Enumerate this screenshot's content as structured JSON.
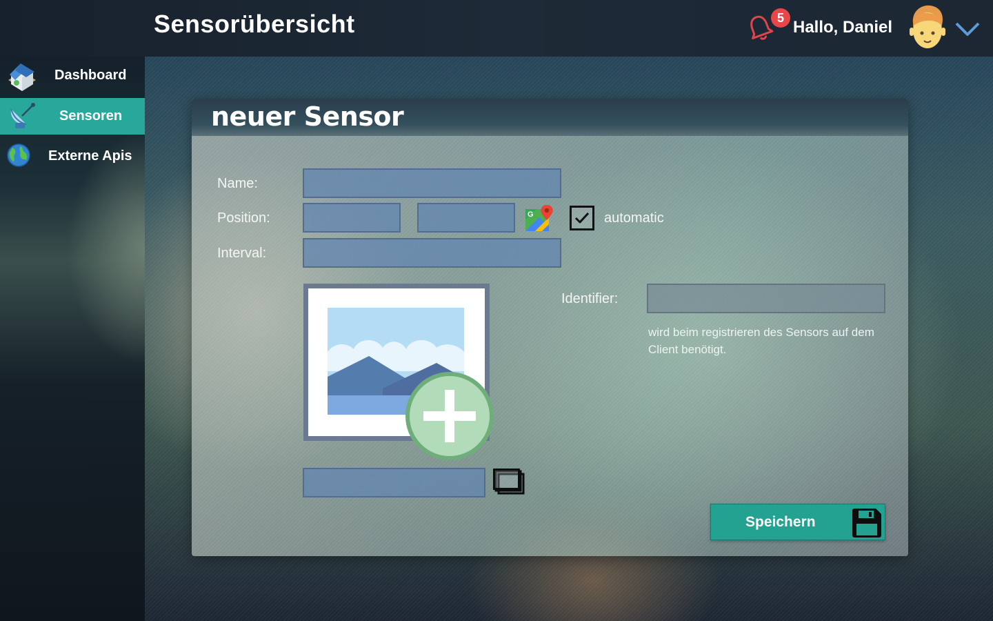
{
  "header": {
    "title": "Sensorübersicht",
    "notification_count": "5",
    "greeting": "Hallo, Daniel",
    "icons": [
      "bell-icon",
      "avatar",
      "chevron-down-icon"
    ]
  },
  "sidebar": {
    "items": [
      {
        "label": "Dashboard",
        "icon": "house-icon",
        "active": false
      },
      {
        "label": "Sensoren",
        "icon": "satellite-dish-icon",
        "active": true
      },
      {
        "label": "Externe Apis",
        "icon": "globe-icon",
        "active": false
      }
    ]
  },
  "form": {
    "title": "neuer Sensor",
    "name_label": "Name:",
    "position_label": "Position:",
    "interval_label": "Interval:",
    "automatic_label": "automatic",
    "automatic_checked": true,
    "identifier_label": "Identifier:",
    "identifier_hint": "wird beim registrieren des Sensors auf dem Client benötigt.",
    "name_value": "",
    "latitude_value": "",
    "longitude_value": "",
    "interval_value": "",
    "identifier_value": "",
    "image_path_value": "",
    "save_label": "Speichern"
  },
  "colors": {
    "accent": "#27a89b",
    "badge": "#e8474a",
    "input": "#6487af"
  }
}
